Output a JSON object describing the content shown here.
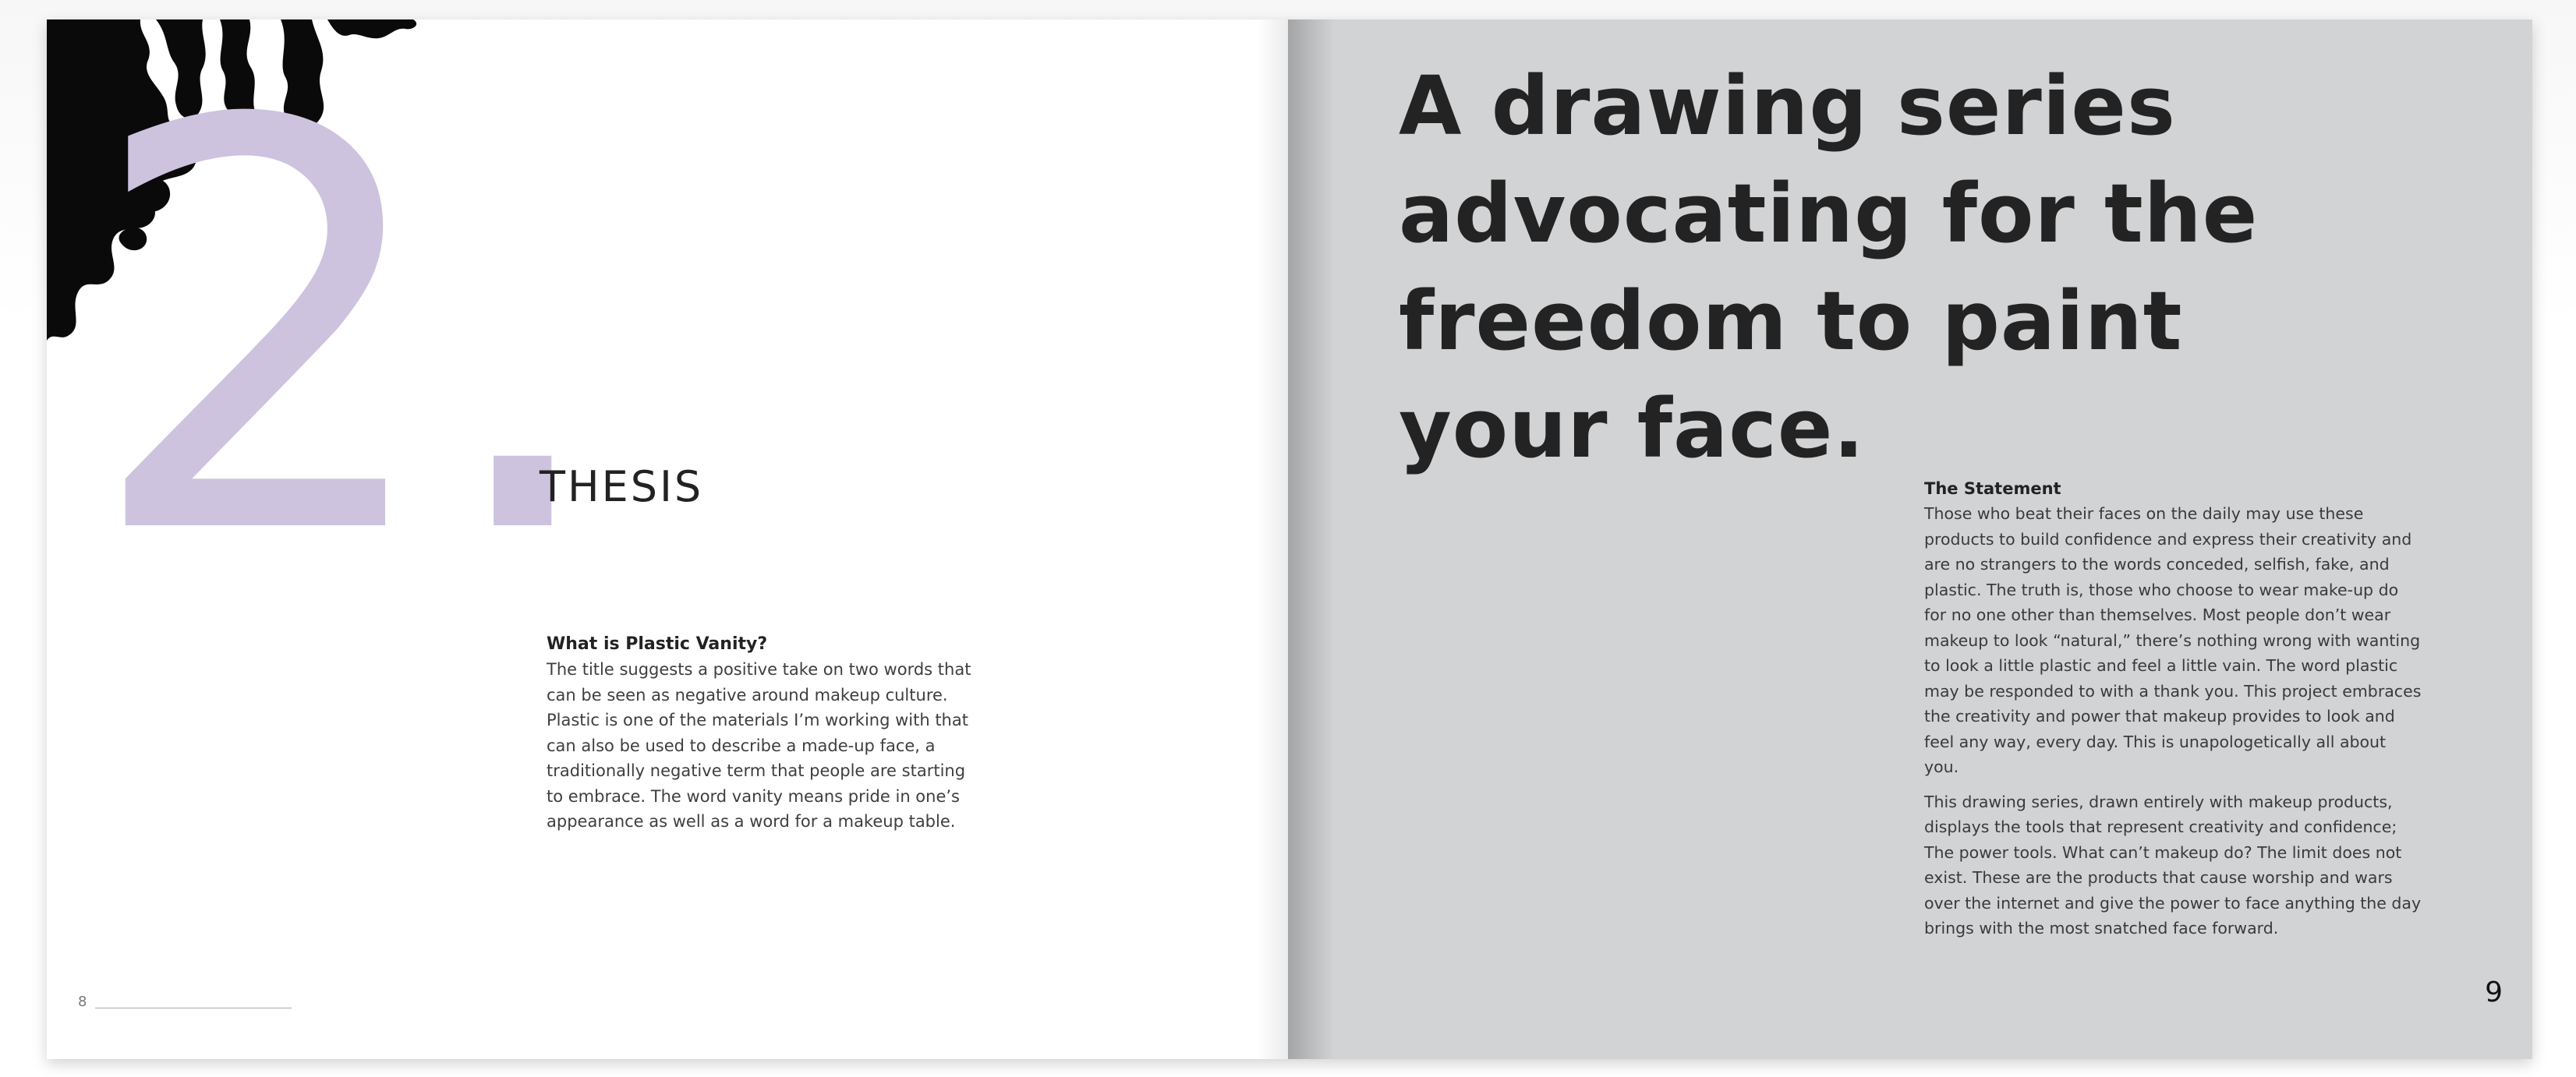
{
  "left_page": {
    "numeral": "2.",
    "section_title": "THESIS",
    "heading": "What is Plastic Vanity?",
    "paragraph": "The title suggests a positive take on two words that can be seen as negative around makeup culture. Plastic is one of the materials I’m working with that can also be used to describe a made-up face, a traditionally negative term that people are starting to embrace. The word vanity means pride in one’s appearance as well as a word for a makeup table.",
    "folio": "8"
  },
  "right_page": {
    "headline": "A drawing series advocating for the freedom to paint your face.",
    "statement_heading": "The Statement",
    "paragraph_1": "Those who beat their faces on the daily may use these products to build confidence and express their creativity and are no strangers to the words conceded, selfish, fake, and plastic. The truth is, those who choose to wear make-up do for no one other than themselves. Most people don’t wear makeup to look “natural,” there’s nothing wrong with wanting to look a little plastic and feel a little vain. The word plastic may be responded to with a thank you. This project embraces the creativity and power that makeup provides to look and feel any way, every day. This is unapologetically all about you.",
    "paragraph_2": "This drawing series, drawn entirely with makeup products, displays the tools that represent creativity and confidence; The power tools. What can’t makeup do? The limit does not exist. These are the products that cause worship and wars over the internet and give the power to face anything the day brings with the most snatched face forward.",
    "folio": "9"
  },
  "colors": {
    "numeral": "#cdc3df",
    "right_page_bg": "#d2d3d5",
    "ink": "#0a0a0a"
  }
}
